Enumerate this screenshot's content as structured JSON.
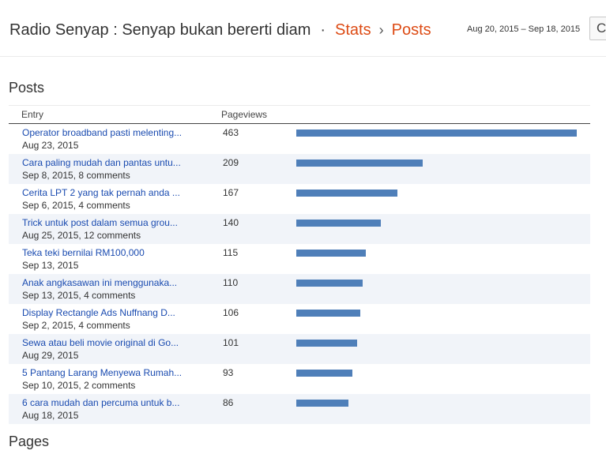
{
  "header": {
    "blog_title": "Radio Senyap : Senyap bukan bererti diam",
    "separator": "·",
    "crumb_stats": "Stats",
    "crumb_chevron": "›",
    "crumb_posts": "Posts",
    "date_range": "Aug 20, 2015 – Sep 18, 2015",
    "refresh_glyph": "C"
  },
  "posts_section": {
    "title": "Posts",
    "col_entry": "Entry",
    "col_pageviews": "Pageviews",
    "max_pageviews": 463,
    "rows": [
      {
        "title": "Operator broadband pasti melenting...",
        "meta": "Aug 23, 2015",
        "views": 463
      },
      {
        "title": "Cara paling mudah dan pantas untu...",
        "meta": "Sep 8, 2015, 8 comments",
        "views": 209
      },
      {
        "title": "Cerita LPT 2 yang tak pernah anda ...",
        "meta": "Sep 6, 2015, 4 comments",
        "views": 167
      },
      {
        "title": "Trick untuk post dalam semua grou...",
        "meta": "Aug 25, 2015, 12 comments",
        "views": 140
      },
      {
        "title": "Teka teki bernilai RM100,000",
        "meta": "Sep 13, 2015",
        "views": 115
      },
      {
        "title": "Anak angkasawan ini menggunaka...",
        "meta": "Sep 13, 2015, 4 comments",
        "views": 110
      },
      {
        "title": "Display Rectangle Ads Nuffnang D...",
        "meta": "Sep 2, 2015, 4 comments",
        "views": 106
      },
      {
        "title": "Sewa atau beli movie original di Go...",
        "meta": "Aug 29, 2015",
        "views": 101
      },
      {
        "title": "5 Pantang Larang Menyewa Rumah...",
        "meta": "Sep 10, 2015, 2 comments",
        "views": 93
      },
      {
        "title": "6 cara mudah dan percuma untuk b...",
        "meta": "Aug 18, 2015",
        "views": 86
      }
    ]
  },
  "pages_section": {
    "title": "Pages"
  },
  "colors": {
    "accent": "#dd4b14",
    "link": "#1a4bb0",
    "bar": "#4f7fb9",
    "row_alt": "#f1f4f9"
  }
}
